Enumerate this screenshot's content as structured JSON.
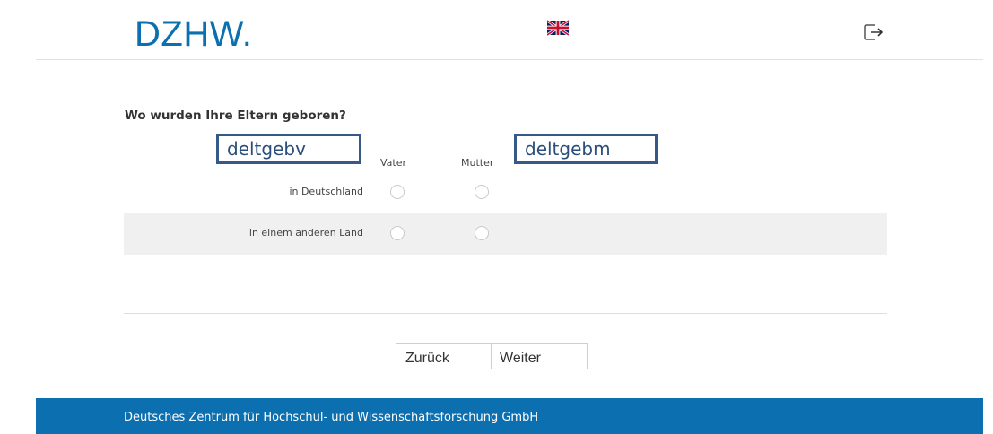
{
  "header": {
    "logo_text": "DZHW.",
    "language_flag_icon": "uk-flag-icon",
    "logout_icon": "logout-icon"
  },
  "question": {
    "title": "Wo wurden Ihre Eltern geboren?",
    "columns": [
      "Vater",
      "Mutter"
    ],
    "rows": [
      {
        "label": "in Deutschland"
      },
      {
        "label": "in einem anderen Land"
      }
    ],
    "annotations": {
      "vater_variable": "deltgebv",
      "mutter_variable": "deltgebm"
    }
  },
  "navigation": {
    "back_label": "Zurück",
    "next_label": "Weiter"
  },
  "footer": {
    "text": "Deutsches Zentrum für Hochschul- und Wissenschaftsforschung GmbH"
  },
  "colors": {
    "brand_blue": "#0b6fb0",
    "annotation_border": "#355a87",
    "row_alt_bg": "#f0f0f0"
  }
}
